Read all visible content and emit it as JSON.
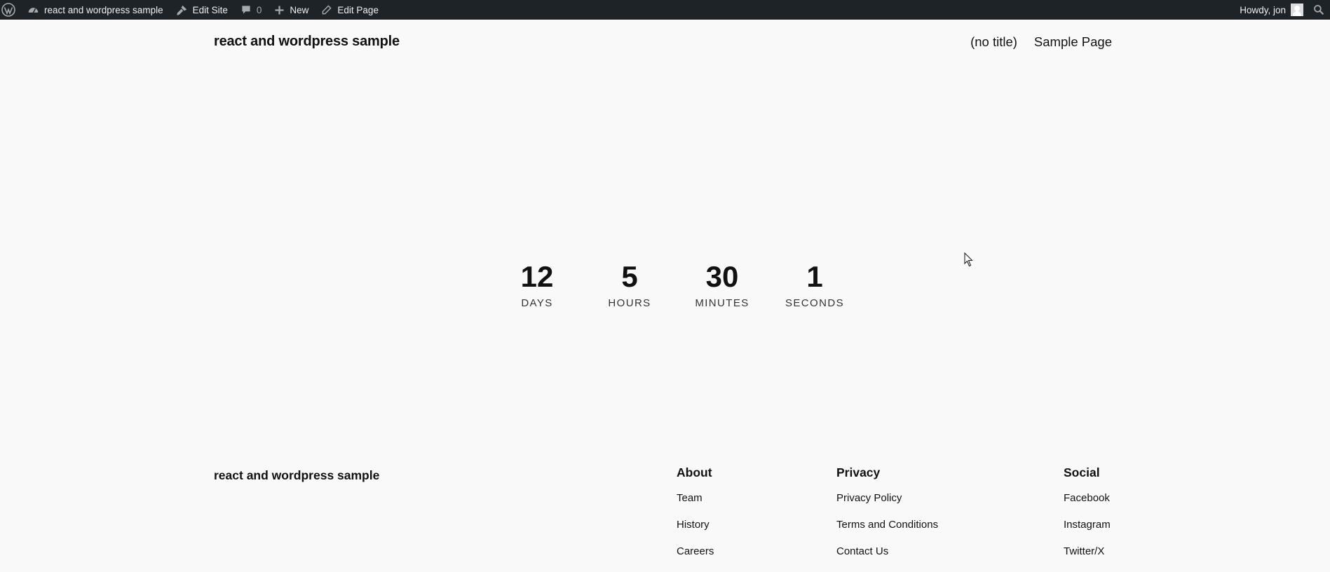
{
  "adminbar": {
    "site_name": "react and wordpress sample",
    "edit_site": "Edit Site",
    "comments_count": "0",
    "new_label": "New",
    "edit_page": "Edit Page",
    "howdy": "Howdy, jon"
  },
  "header": {
    "site_title": "react and wordpress sample",
    "nav": [
      "(no title)",
      "Sample Page"
    ]
  },
  "countdown": [
    {
      "value": "12",
      "label": "DAYS"
    },
    {
      "value": "5",
      "label": "HOURS"
    },
    {
      "value": "30",
      "label": "MINUTES"
    },
    {
      "value": "1",
      "label": "SECONDS"
    }
  ],
  "footer": {
    "site_title": "react and wordpress sample",
    "columns": [
      {
        "heading": "About",
        "links": [
          "Team",
          "History",
          "Careers"
        ]
      },
      {
        "heading": "Privacy",
        "links": [
          "Privacy Policy",
          "Terms and Conditions",
          "Contact Us"
        ]
      },
      {
        "heading": "Social",
        "links": [
          "Facebook",
          "Instagram",
          "Twitter/X"
        ]
      }
    ]
  },
  "colors": {
    "adminbar_bg": "#1d2327",
    "page_bg": "#f9f9f9",
    "text": "#111111"
  }
}
